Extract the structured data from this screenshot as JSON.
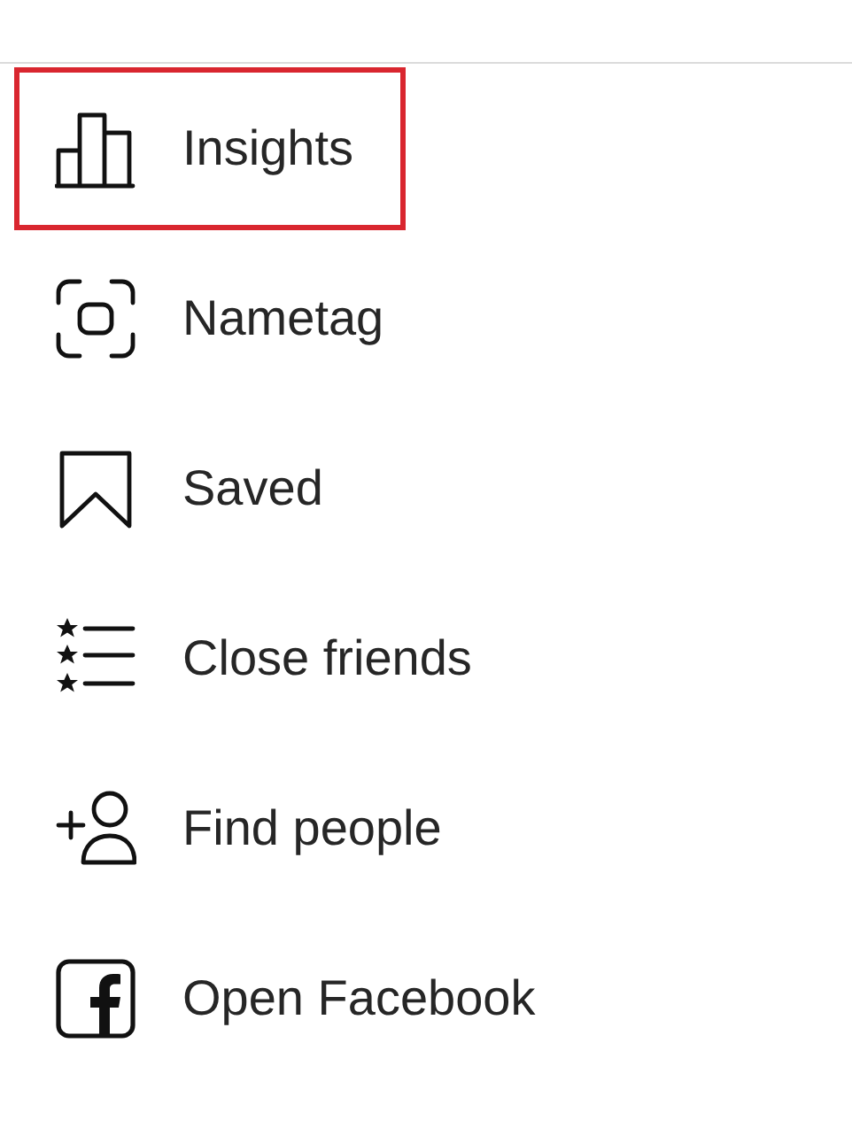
{
  "menu": {
    "items": [
      {
        "kind": "insights",
        "label": "Insights",
        "selected": true
      },
      {
        "kind": "nametag",
        "label": "Nametag",
        "selected": false
      },
      {
        "kind": "saved",
        "label": "Saved",
        "selected": false
      },
      {
        "kind": "close_friends",
        "label": "Close friends",
        "selected": false
      },
      {
        "kind": "find_people",
        "label": "Find people",
        "selected": false
      },
      {
        "kind": "facebook",
        "label": "Open Facebook",
        "selected": false
      }
    ]
  }
}
